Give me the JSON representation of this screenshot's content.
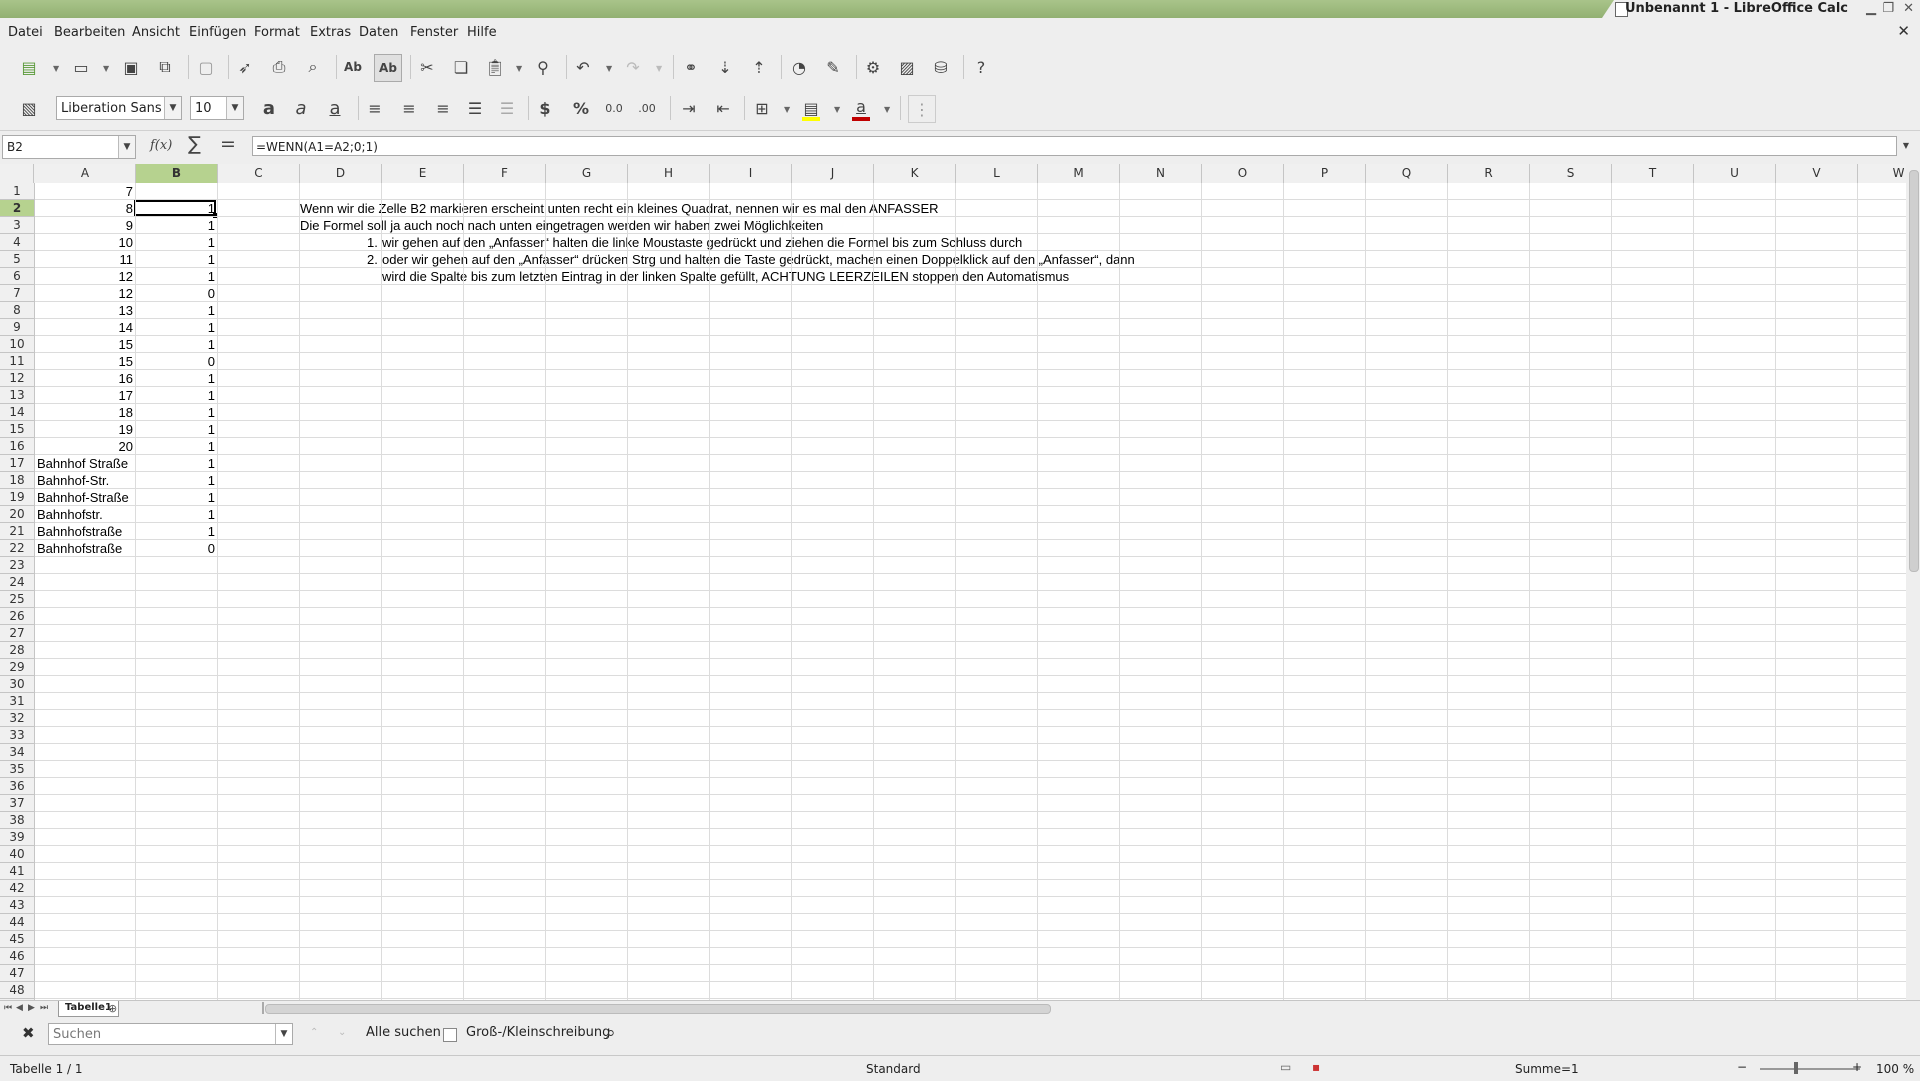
{
  "titlebar": {
    "title": "Unbenannt 1 - LibreOffice Calc"
  },
  "menu": [
    "Datei",
    "Bearbeiten",
    "Ansicht",
    "Einfügen",
    "Format",
    "Extras",
    "Daten",
    "Fenster",
    "Hilfe"
  ],
  "formatting": {
    "font_name": "Liberation Sans",
    "font_size": "10",
    "font_color": "#c00000",
    "highlight_color": "#ffff00"
  },
  "formula_bar": {
    "name_box": "B2",
    "formula": "=WENN(A1=A2;0;1)",
    "fx_label": "f(x)"
  },
  "columns": [
    "A",
    "B",
    "C",
    "D",
    "E",
    "F",
    "G",
    "H",
    "I",
    "J",
    "K",
    "L",
    "M",
    "N",
    "O",
    "P",
    "Q",
    "R",
    "S",
    "T",
    "U",
    "V",
    "W"
  ],
  "selected_column": "B",
  "selected_row": 2,
  "row_count": 48,
  "cells": {
    "A1": "7",
    "A2": "8",
    "A3": "9",
    "A4": "10",
    "A5": "11",
    "A6": "12",
    "A7": "12",
    "A8": "13",
    "A9": "14",
    "A10": "15",
    "A11": "15",
    "A12": "16",
    "A13": "17",
    "A14": "18",
    "A15": "19",
    "A16": "20",
    "A17": "Bahnhof Straße",
    "A18": "Bahnhof-Str.",
    "A19": "Bahnhof-Straße",
    "A20": "Bahnhofstr.",
    "A21": "Bahnhofstraße",
    "A22": "Bahnhofstraße",
    "B2": "1",
    "B3": "1",
    "B4": "1",
    "B5": "1",
    "B6": "1",
    "B7": "0",
    "B8": "1",
    "B9": "1",
    "B10": "1",
    "B11": "0",
    "B12": "1",
    "B13": "1",
    "B14": "1",
    "B15": "1",
    "B16": "1",
    "B17": "1",
    "B18": "1",
    "B19": "1",
    "B20": "1",
    "B21": "1",
    "B22": "0"
  },
  "notes": {
    "line1": "Wenn wir die Zelle B2 markieren erscheint unten recht ein kleines Quadrat, nennen wir es mal den ANFASSER",
    "line2": "Die Formel soll ja auch noch nach unten eingetragen werden wir haben zwei Möglichkeiten",
    "item1_num": "1.",
    "item1": "wir gehen auf den „Anfasser“ halten die linke Moustaste gedrückt und ziehen die Formel bis zum Schluss durch",
    "item2_num": "2.",
    "item2": "oder wir gehen auf den „Anfasser“ drücken Strg und halten die Taste gedrückt, machen einen Doppelklick auf den „Anfasser“, dann",
    "item2_cont": "wird die Spalte bis zum letzten Eintrag in der linken Spalte gefüllt, ACHTUNG LEERZEILEN stoppen den Automatismus"
  },
  "sheet_tabs": [
    {
      "label": "Tabelle1",
      "active": true
    }
  ],
  "findbar": {
    "placeholder": "Suchen",
    "find_all": "Alle suchen",
    "match_case": "Groß-/Kleinschreibung"
  },
  "statusbar": {
    "sheet": "Tabelle 1 / 1",
    "style": "Standard",
    "sum": "Summe=1",
    "zoom": "100 %"
  },
  "icons": [
    "new-icon",
    "open-icon",
    "save-icon",
    "export-pdf-icon",
    "print-icon",
    "print-preview-icon",
    "spellcheck-icon",
    "autospell-icon",
    "cut-icon",
    "copy-icon",
    "paste-icon",
    "clone-format-icon",
    "undo-icon",
    "redo-icon",
    "hyperlink-icon",
    "sort-asc-icon",
    "sort-desc-icon",
    "chart-icon",
    "draw-icon",
    "macro-icon",
    "image-icon",
    "datasource-icon",
    "help-icon"
  ]
}
